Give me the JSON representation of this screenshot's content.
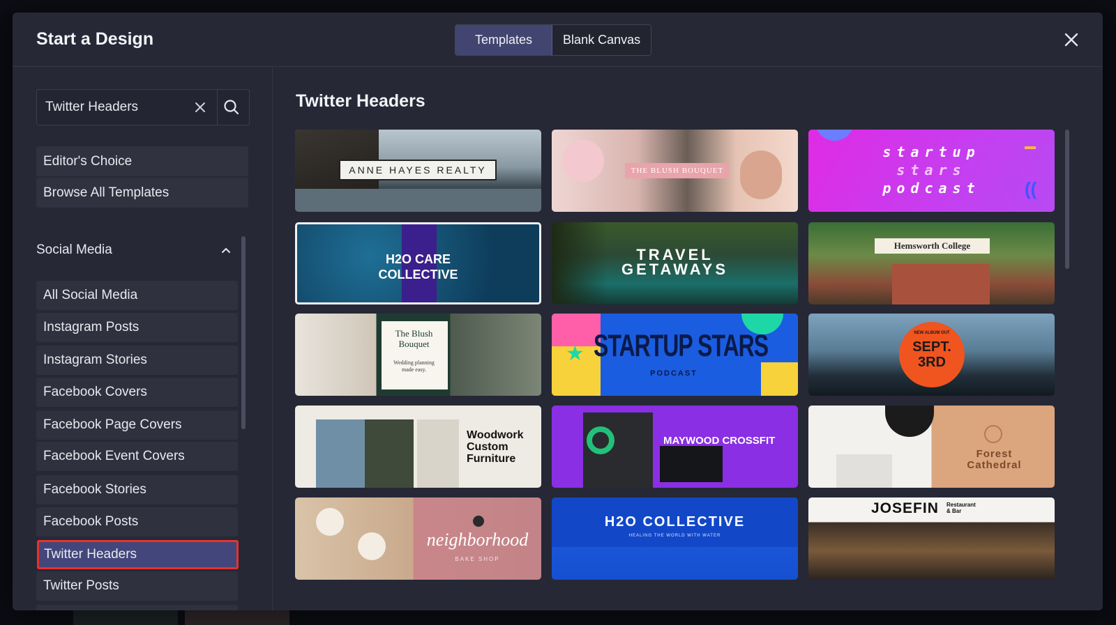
{
  "dialog": {
    "title": "Start a Design"
  },
  "tabs": {
    "templates": "Templates",
    "blank": "Blank Canvas"
  },
  "search": {
    "value": "Twitter Headers"
  },
  "sidebar": {
    "top_items": [
      "Editor's Choice",
      "Browse All Templates"
    ],
    "section": "Social Media",
    "categories": [
      "All Social Media",
      "Instagram Posts",
      "Instagram Stories",
      "Facebook Covers",
      "Facebook Page Covers",
      "Facebook Event Covers",
      "Facebook Stories",
      "Facebook Posts",
      "Twitter Headers",
      "Twitter Posts"
    ],
    "selected": "Twitter Headers"
  },
  "main": {
    "title": "Twitter Headers"
  },
  "templates": [
    {
      "name": "anne-hayes-realty",
      "text": [
        "ANNE HAYES REALTY"
      ]
    },
    {
      "name": "blush-bouquet-wedding",
      "text": [
        "THE BLUSH BOUQUET"
      ]
    },
    {
      "name": "startup-stars-podcast-pink",
      "text": [
        "startup",
        "stars",
        "podcast"
      ]
    },
    {
      "name": "h2o-care-collective",
      "text": [
        "H2O CARE",
        "COLLECTIVE"
      ]
    },
    {
      "name": "travel-getaways",
      "text": [
        "TRAVEL",
        "GETAWAYS"
      ]
    },
    {
      "name": "hemsworth-college",
      "text": [
        "Hemsworth College"
      ]
    },
    {
      "name": "blush-bouquet-planning",
      "text": [
        "The Blush",
        "Bouquet",
        "Wedding planning",
        "made easy."
      ]
    },
    {
      "name": "startup-stars-podcast-blue",
      "text": [
        "STARTUP STARS",
        "PODCAST"
      ]
    },
    {
      "name": "new-album-sept-3rd",
      "text": [
        "NEW ALBUM OUT",
        "SEPT.",
        "3RD"
      ]
    },
    {
      "name": "woodwork-custom-furniture",
      "text": [
        "Woodwork",
        "Custom",
        "Furniture"
      ]
    },
    {
      "name": "maywood-crossfit",
      "text": [
        "MAYWOOD CROSSFIT"
      ]
    },
    {
      "name": "forest-cathedral",
      "text": [
        "Forest",
        "Cathedral"
      ]
    },
    {
      "name": "neighborhood-bake-shop",
      "text": [
        "neighborhood",
        "BAKE SHOP"
      ]
    },
    {
      "name": "h2o-collective",
      "text": [
        "H2O COLLECTIVE",
        "HEALING THE WORLD WITH WATER"
      ]
    },
    {
      "name": "josefin-restaurant",
      "text": [
        "JOSEFIN",
        "Restaurant",
        "& Bar"
      ]
    }
  ],
  "colors": {
    "accent": "#42456f",
    "selected_outline": "#e8322b",
    "surface": "#262836"
  }
}
